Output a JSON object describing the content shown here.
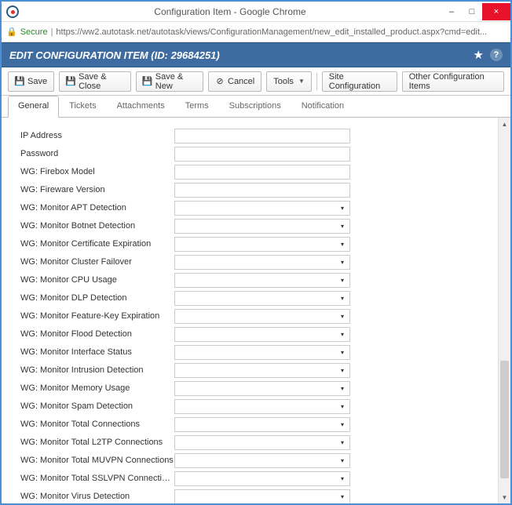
{
  "window": {
    "title": "Configuration Item - Google Chrome",
    "minimize": "–",
    "maximize": "□",
    "close": "×"
  },
  "address": {
    "secure": "Secure",
    "url": "https://ww2.autotask.net/autotask/views/ConfigurationManagement/new_edit_installed_product.aspx?cmd=edit..."
  },
  "header": {
    "title": "EDIT CONFIGURATION ITEM (ID: 29684251)"
  },
  "toolbar": {
    "save": "Save",
    "save_close": "Save & Close",
    "save_new": "Save & New",
    "cancel": "Cancel",
    "tools": "Tools",
    "site_config": "Site Configuration",
    "other_config": "Other Configuration Items"
  },
  "tabs": [
    {
      "label": "General",
      "active": true
    },
    {
      "label": "Tickets"
    },
    {
      "label": "Attachments"
    },
    {
      "label": "Terms"
    },
    {
      "label": "Subscriptions"
    },
    {
      "label": "Notification"
    }
  ],
  "fields": [
    {
      "label": "IP Address",
      "type": "text"
    },
    {
      "label": "Password",
      "type": "text"
    },
    {
      "label": "WG: Firebox Model",
      "type": "text"
    },
    {
      "label": "WG: Fireware Version",
      "type": "text"
    },
    {
      "label": "WG: Monitor APT Detection",
      "type": "select"
    },
    {
      "label": "WG: Monitor Botnet Detection",
      "type": "select"
    },
    {
      "label": "WG: Monitor Certificate Expiration",
      "type": "select"
    },
    {
      "label": "WG: Monitor Cluster Failover",
      "type": "select"
    },
    {
      "label": "WG: Monitor CPU Usage",
      "type": "select"
    },
    {
      "label": "WG: Monitor DLP Detection",
      "type": "select"
    },
    {
      "label": "WG: Monitor Feature-Key Expiration",
      "type": "select"
    },
    {
      "label": "WG: Monitor Flood Detection",
      "type": "select"
    },
    {
      "label": "WG: Monitor Interface Status",
      "type": "select"
    },
    {
      "label": "WG: Monitor Intrusion Detection",
      "type": "select"
    },
    {
      "label": "WG: Monitor Memory Usage",
      "type": "select"
    },
    {
      "label": "WG: Monitor Spam Detection",
      "type": "select"
    },
    {
      "label": "WG: Monitor Total Connections",
      "type": "select"
    },
    {
      "label": "WG: Monitor Total L2TP Connections",
      "type": "select"
    },
    {
      "label": "WG: Monitor Total MUVPN Connections",
      "type": "select"
    },
    {
      "label": "WG: Monitor Total SSLVPN Connections",
      "type": "select"
    },
    {
      "label": "WG: Monitor Virus Detection",
      "type": "select"
    }
  ]
}
